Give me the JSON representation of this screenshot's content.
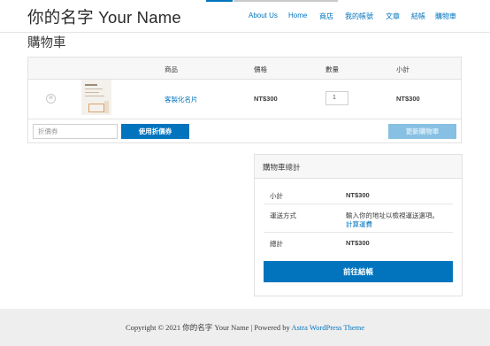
{
  "site": {
    "title": "你的名字 Your Name"
  },
  "nav": {
    "items": [
      "About Us",
      "Home",
      "商店",
      "我的帳號",
      "文章",
      "結帳",
      "購物車"
    ]
  },
  "page": {
    "title": "購物車"
  },
  "cart": {
    "headers": {
      "product": "商品",
      "price": "價格",
      "quantity": "數量",
      "subtotal": "小計"
    },
    "item": {
      "remove_icon": "⊗",
      "name": "客製化名片",
      "price": "NT$300",
      "quantity": "1",
      "subtotal": "NT$300"
    },
    "coupon": {
      "placeholder": "折價券",
      "apply_label": "使用折價券"
    },
    "update_label": "更新購物車"
  },
  "totals": {
    "title": "購物車總計",
    "subtotal_label": "小計",
    "subtotal_value": "NT$300",
    "shipping_label": "運送方式",
    "shipping_note": "輸入你的地址以檢視運送選項。",
    "shipping_link": "計算運費",
    "total_label": "總計",
    "total_value": "NT$300",
    "checkout_label": "前往結帳"
  },
  "footer": {
    "text_before": "Copyright © 2021 你的名字 Your Name | Powered by ",
    "link": "Astra WordPress Theme"
  },
  "colors": {
    "accent": "#0274be",
    "accent_disabled": "#87c0e2",
    "footer_bg": "#eeeeee"
  }
}
